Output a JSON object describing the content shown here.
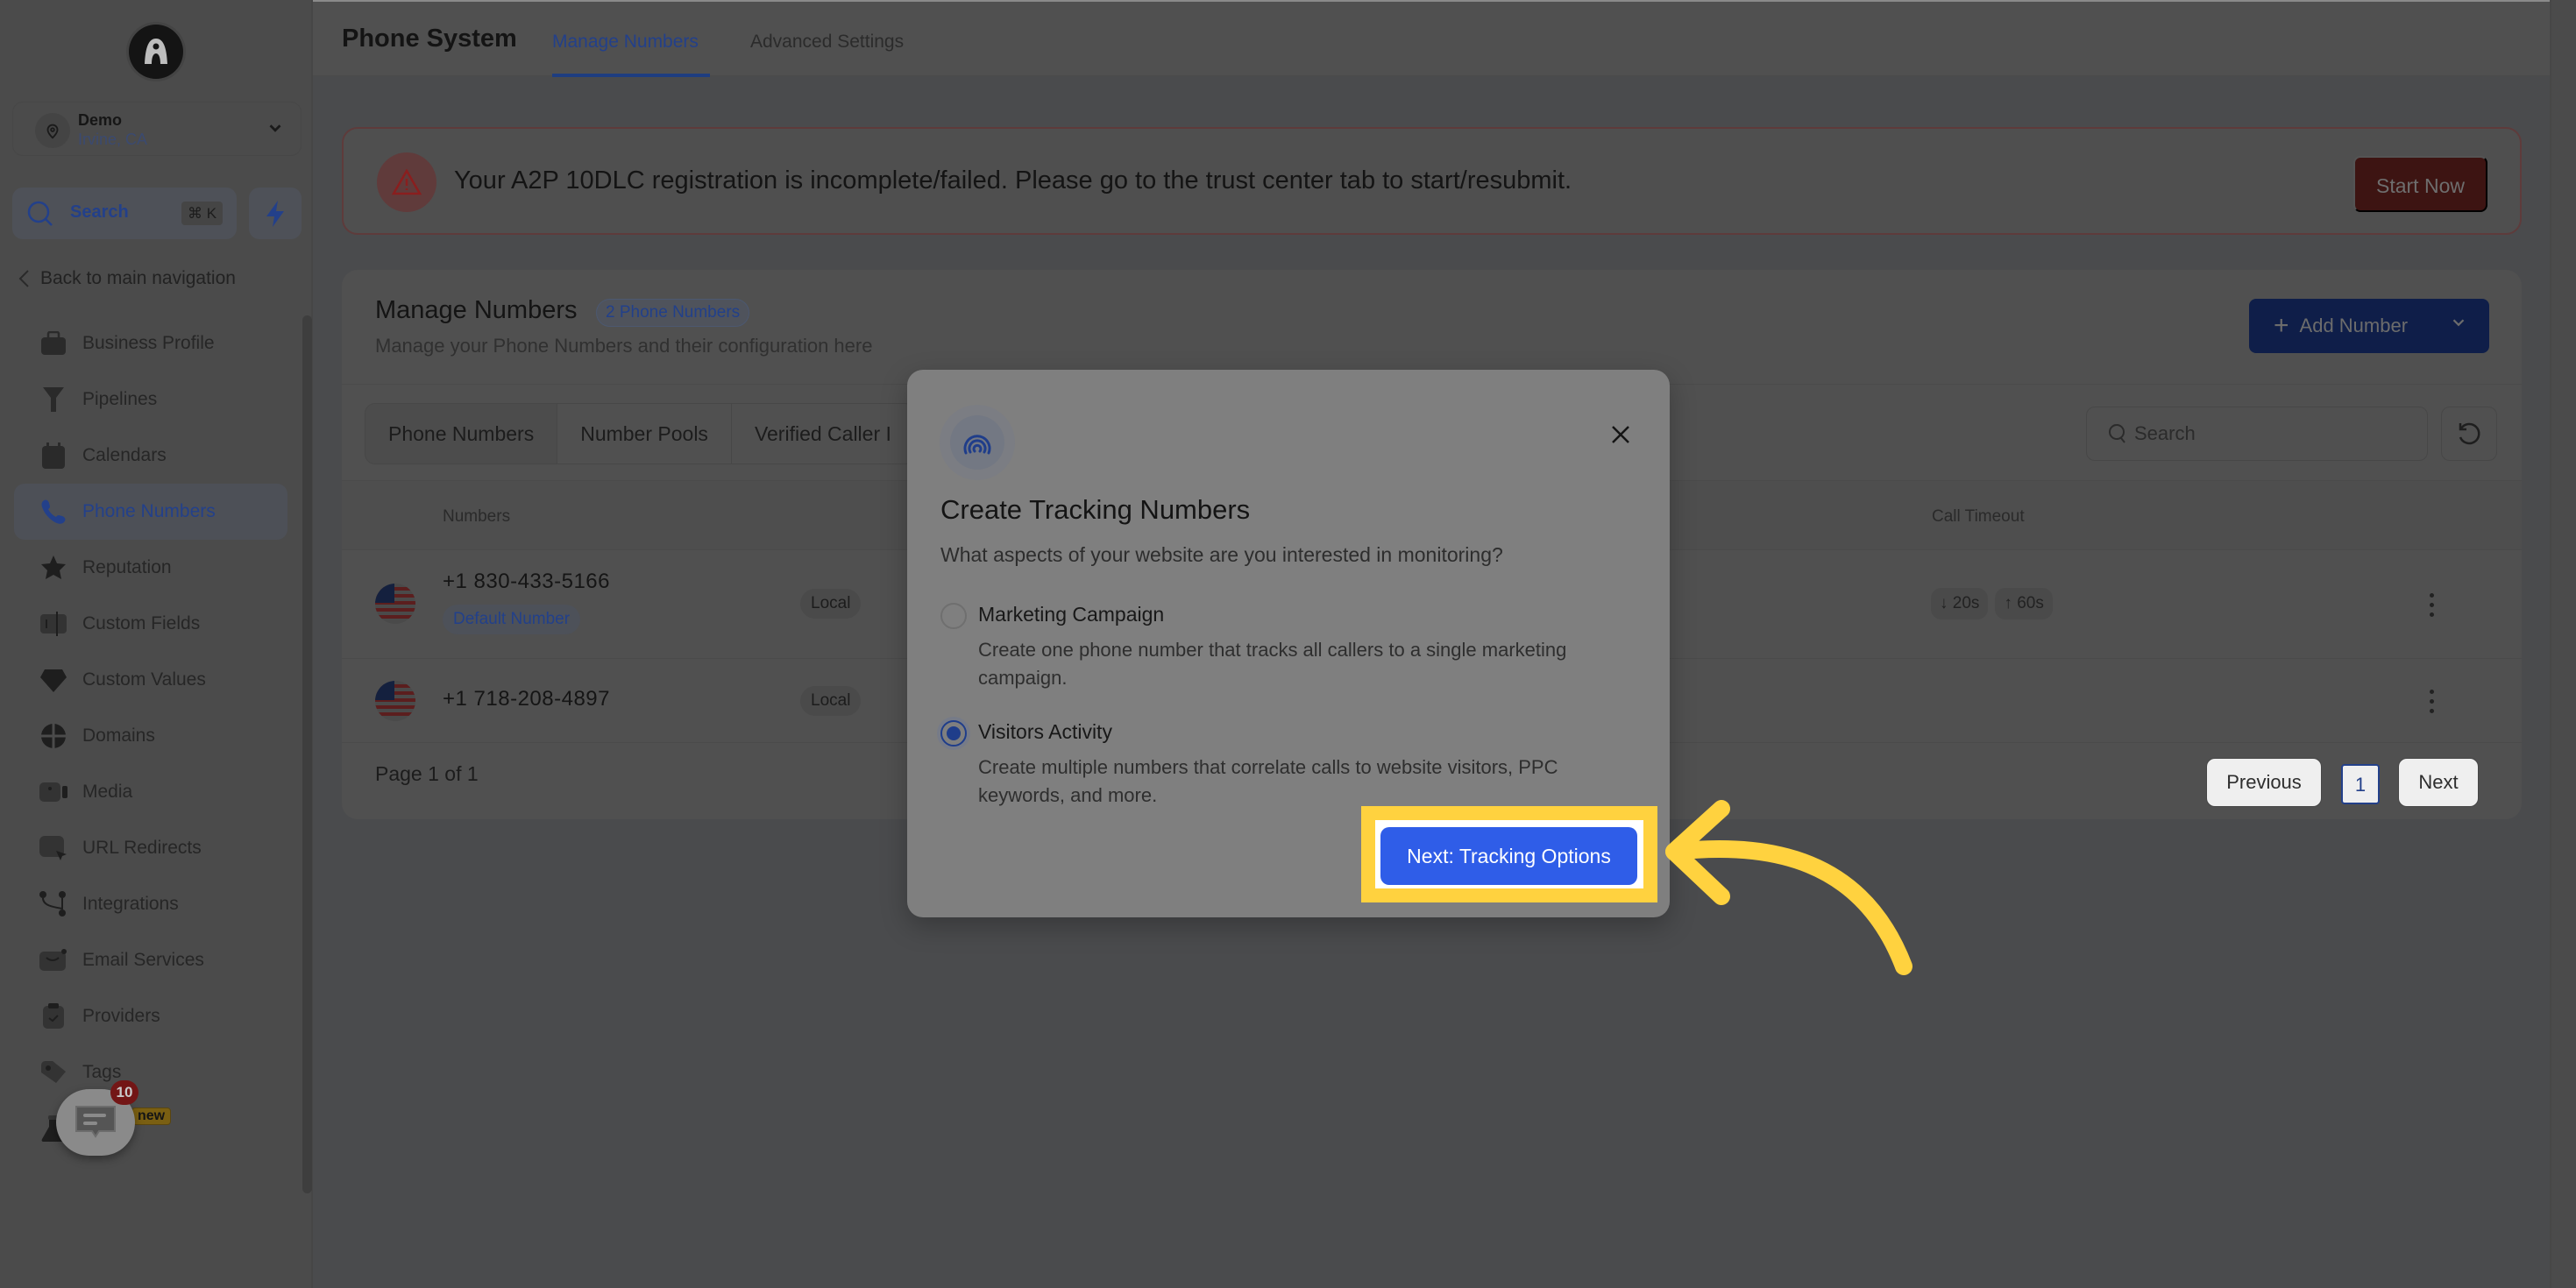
{
  "sidebar": {
    "location": {
      "name": "Demo",
      "city": "Irvine, CA"
    },
    "search": {
      "label": "Search",
      "shortcut": "⌘ K"
    },
    "back_label": "Back to main navigation",
    "items": [
      {
        "label": "Business Profile",
        "icon": "briefcase-icon"
      },
      {
        "label": "Pipelines",
        "icon": "funnel-icon"
      },
      {
        "label": "Calendars",
        "icon": "calendar-icon"
      },
      {
        "label": "Phone Numbers",
        "icon": "phone-icon",
        "active": true
      },
      {
        "label": "Reputation",
        "icon": "star-icon"
      },
      {
        "label": "Custom Fields",
        "icon": "custom-fields-icon"
      },
      {
        "label": "Custom Values",
        "icon": "gem-icon"
      },
      {
        "label": "Domains",
        "icon": "globe-icon"
      },
      {
        "label": "Media",
        "icon": "video-icon"
      },
      {
        "label": "URL Redirects",
        "icon": "cursor-icon"
      },
      {
        "label": "Integrations",
        "icon": "git-branch-icon"
      },
      {
        "label": "Email Services",
        "icon": "mail-icon"
      },
      {
        "label": "Providers",
        "icon": "clipboard-check-icon"
      },
      {
        "label": "Tags",
        "icon": "tag-icon"
      },
      {
        "label": "Labs",
        "icon": "flask-icon",
        "badge": "new"
      }
    ],
    "chat_badge": "10"
  },
  "header": {
    "title": "Phone System",
    "tabs": [
      {
        "label": "Manage Numbers",
        "active": true
      },
      {
        "label": "Advanced Settings",
        "active": false
      }
    ]
  },
  "banner": {
    "message": "Your A2P 10DLC registration is incomplete/failed. Please go to the trust center tab to start/resubmit.",
    "action_label": "Start Now"
  },
  "manage": {
    "title": "Manage Numbers",
    "count_badge": "2 Phone Numbers",
    "subtitle": "Manage your Phone Numbers and their configuration here",
    "add_button": "Add Number",
    "segments": [
      "Phone Numbers",
      "Number Pools",
      "Verified Caller I"
    ],
    "search_placeholder": "Search",
    "columns": {
      "numbers": "Numbers",
      "call_timeout": "Call Timeout"
    },
    "rows": [
      {
        "number": "+1 830-433-5166",
        "default_label": "Default Number",
        "type": "Local",
        "timeout_in": "↓ 20s",
        "timeout_out": "↑ 60s"
      },
      {
        "number": "+1 718-208-4897",
        "type": "Local"
      }
    ],
    "pagination": {
      "summary": "Page 1 of 1",
      "previous": "Previous",
      "current": "1",
      "next": "Next"
    }
  },
  "modal": {
    "title": "Create Tracking Numbers",
    "subtitle": "What aspects of your website are you interested in monitoring?",
    "options": [
      {
        "label": "Marketing Campaign",
        "description": "Create one phone number that tracks all callers to a single marketing campaign.",
        "selected": false
      },
      {
        "label": "Visitors Activity",
        "description": "Create multiple numbers that correlate calls to website visitors, PPC keywords, and more.",
        "selected": true
      }
    ],
    "next_button": "Next: Tracking Options"
  },
  "colors": {
    "primary": "#2f5de8",
    "highlight": "#ffd23f",
    "danger": "#3d1412"
  }
}
